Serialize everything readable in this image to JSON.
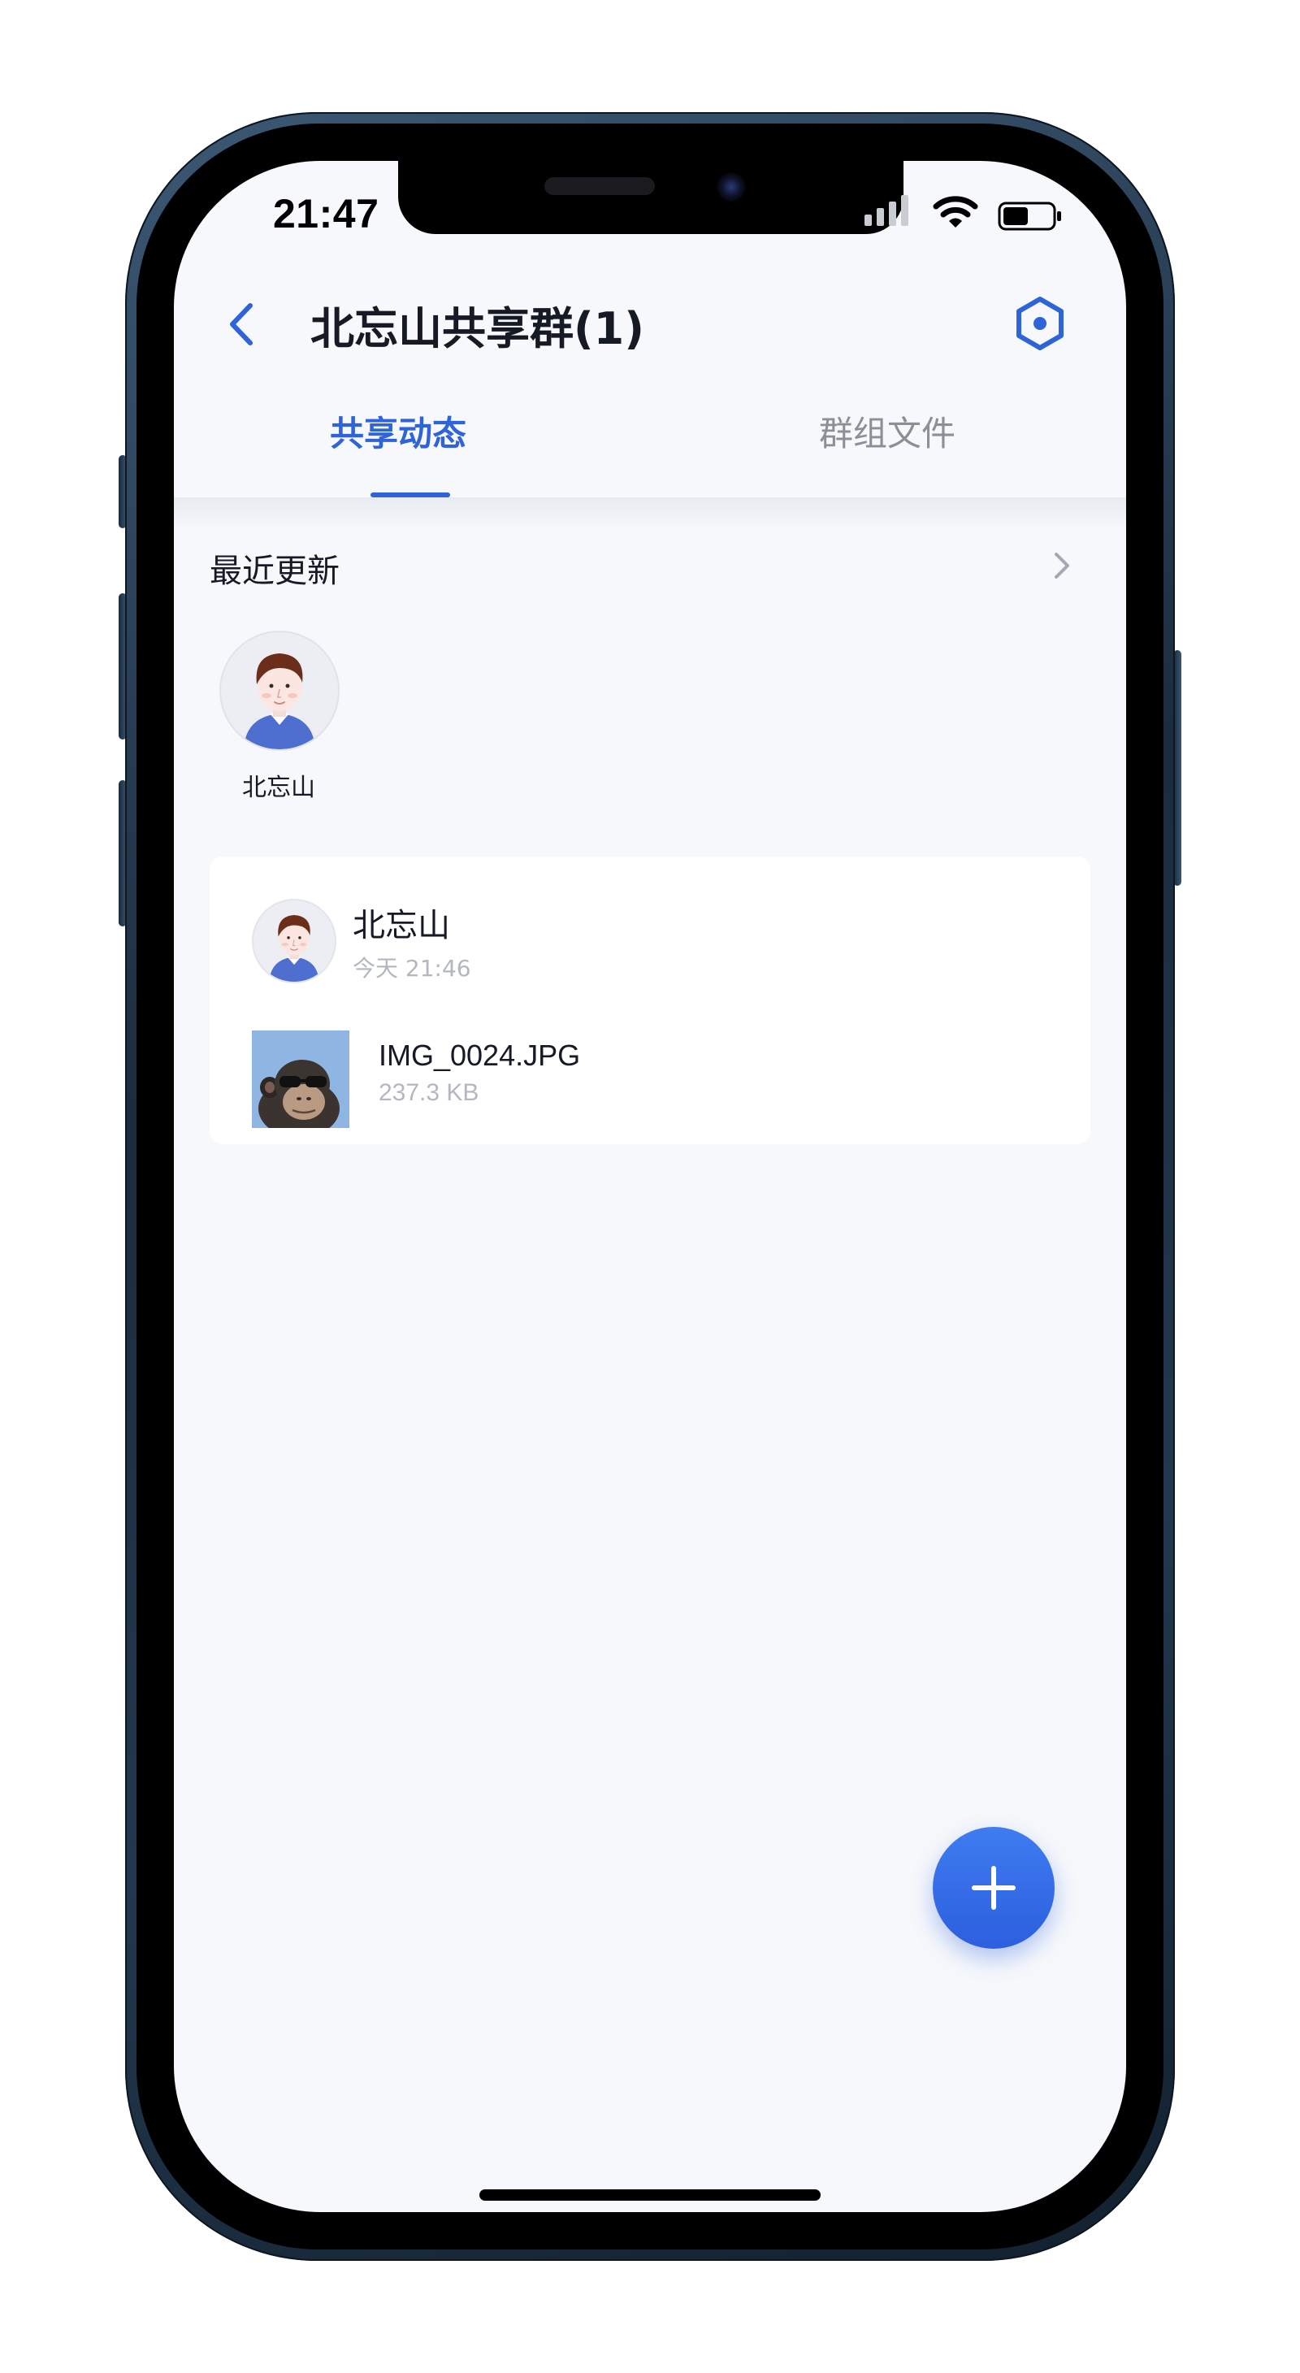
{
  "status_bar": {
    "time": "21:47"
  },
  "nav": {
    "title": "北忘山共享群(1)",
    "back_icon": "chevron-left-icon",
    "settings_icon": "hexagon-settings-icon"
  },
  "tabs": [
    {
      "label": "共享动态",
      "active": true
    },
    {
      "label": "群组文件",
      "active": false
    }
  ],
  "recent": {
    "title": "最近更新",
    "members": [
      {
        "name": "北忘山"
      }
    ]
  },
  "feed": [
    {
      "user": "北忘山",
      "time": "今天 21:46",
      "file": {
        "name": "IMG_0024.JPG",
        "size": "237.3 KB"
      }
    }
  ],
  "fab": {
    "icon": "plus-icon"
  },
  "colors": {
    "accent": "#2f63d8",
    "background": "#f6f8fb",
    "text_primary": "#161a24",
    "text_secondary": "#b3b7bf",
    "tab_inactive": "#8a8f98"
  }
}
